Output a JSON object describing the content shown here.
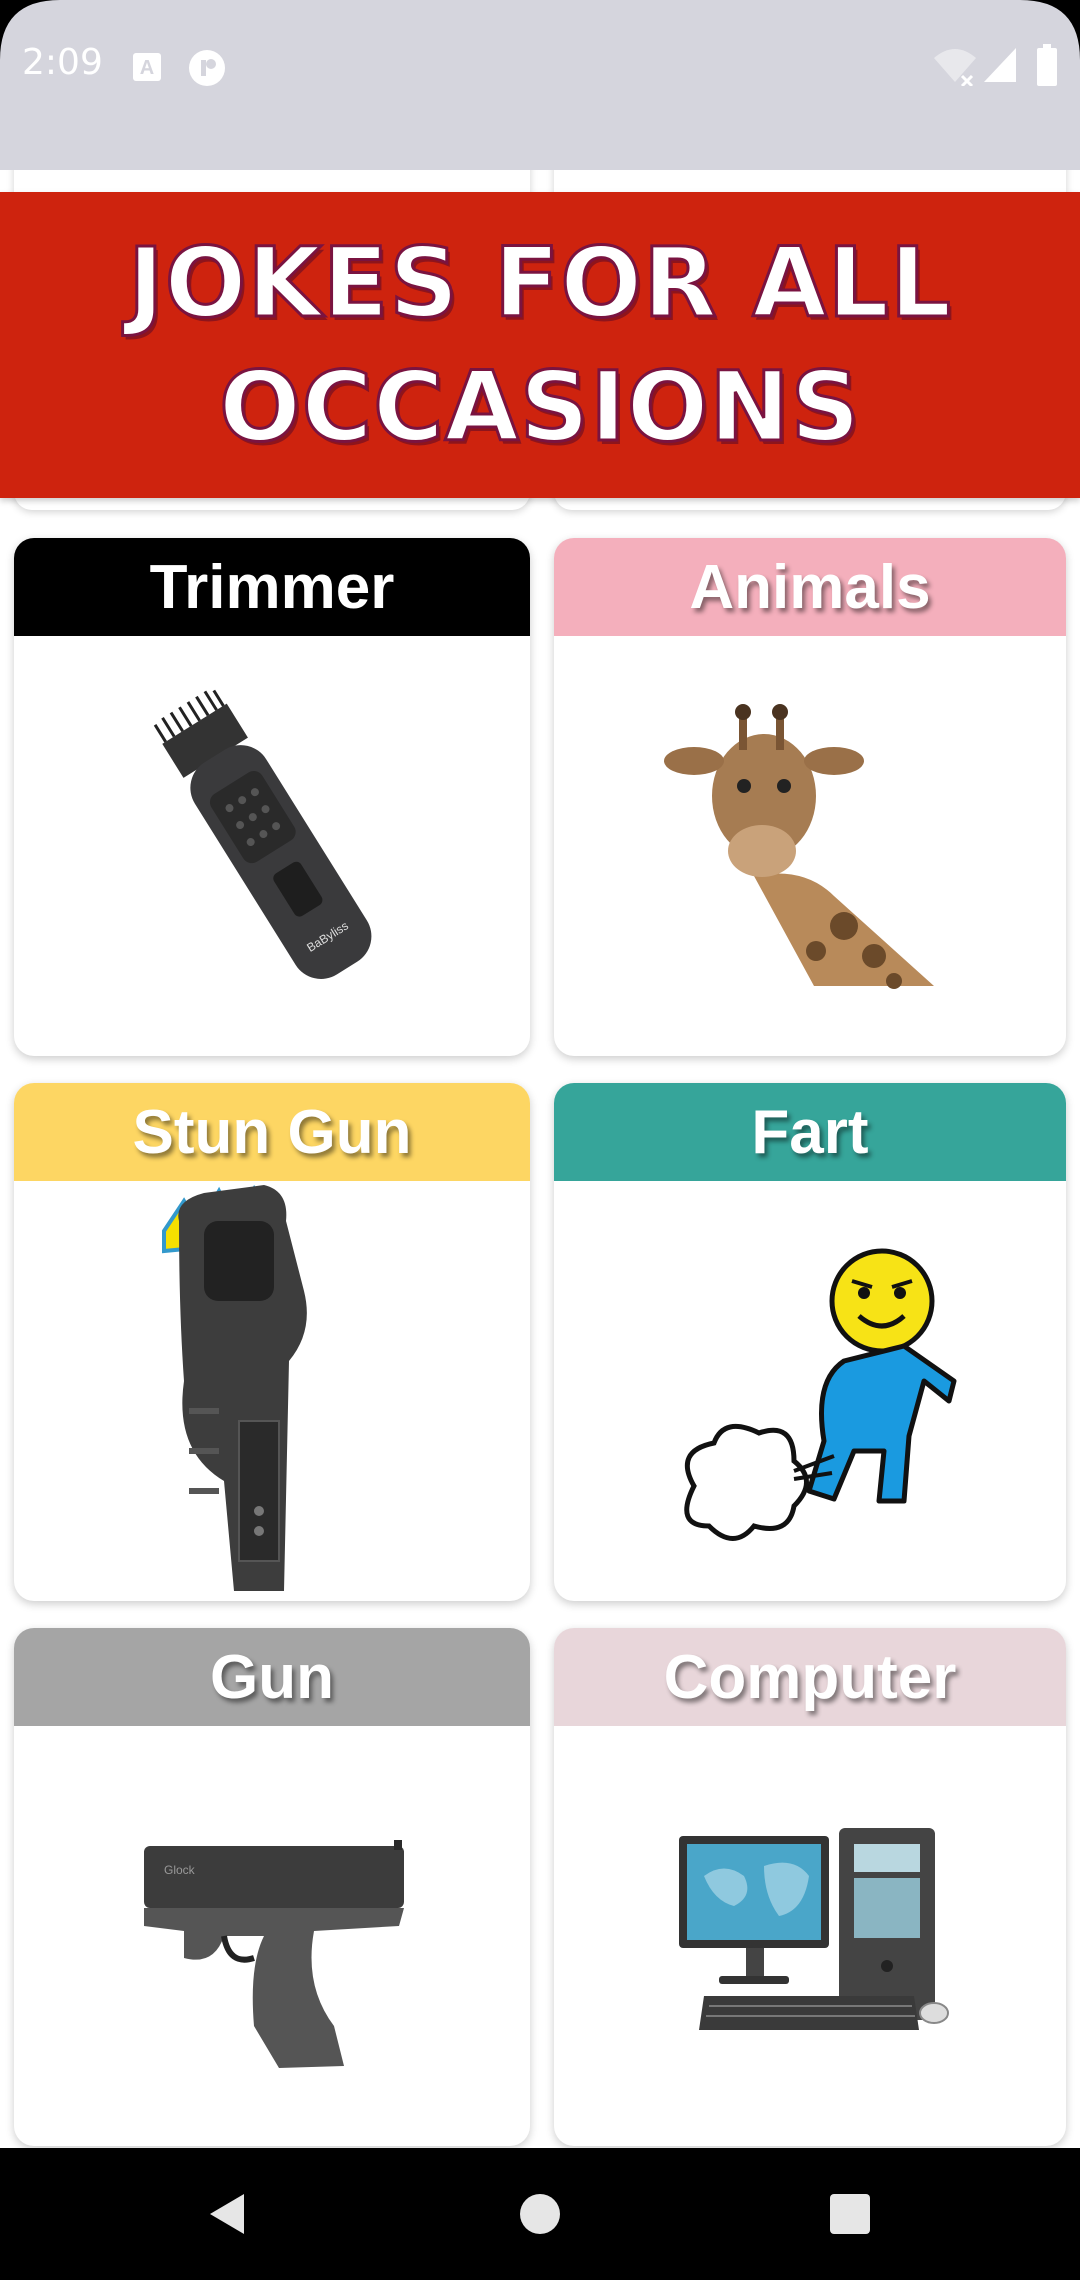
{
  "status_bar": {
    "time": "2:09",
    "icons": [
      "keyboard-a-icon",
      "assistant-icon",
      "wifi-off-icon",
      "signal-icon",
      "battery-icon"
    ]
  },
  "banner": {
    "line1": "JOKES FOR ALL",
    "line2": "OCCASIONS",
    "background": "#ce230e"
  },
  "categories": [
    {
      "label": "Trimmer",
      "color": "#000000",
      "icon": "trimmer-icon"
    },
    {
      "label": "Animals",
      "color": "#f4afbc",
      "icon": "giraffe-icon"
    },
    {
      "label": "Stun Gun",
      "color": "#fdd663",
      "icon": "stun-gun-icon"
    },
    {
      "label": "Fart",
      "color": "#36a59a",
      "icon": "fart-icon"
    },
    {
      "label": "Gun",
      "color": "#a5a5a5",
      "icon": "pistol-icon"
    },
    {
      "label": "Computer",
      "color": "#e8d6da",
      "icon": "computer-icon"
    }
  ],
  "nav_bar": {
    "buttons": [
      "back-icon",
      "home-icon",
      "recents-icon"
    ]
  }
}
